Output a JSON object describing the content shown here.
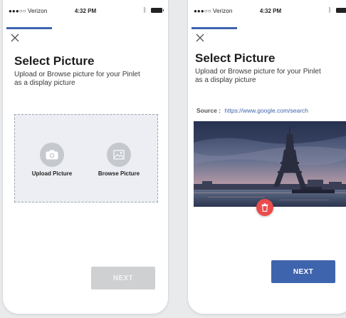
{
  "status_bar": {
    "carrier": "●●●○○ Verizon",
    "time": "4:32 PM",
    "bluetooth_icon": "bluetooth-icon",
    "battery_icon": "battery-icon"
  },
  "colors": {
    "accent": "#3f64ae",
    "delete": "#eb4b4b",
    "disabled_button": "#cfd0d2"
  },
  "screen_left": {
    "title": "Select Picture",
    "subtitle": "Upload or Browse picture for your Pinlet as a display picture",
    "upload_label": "Upload Picture",
    "browse_label": "Browse Picture",
    "next_label": "NEXT",
    "next_enabled": false
  },
  "screen_right": {
    "title": "Select Picture",
    "subtitle": "Upload or Browse picture for your Pinlet as a display picture",
    "source_label": "Source :",
    "source_url": "https://www.google.com/search",
    "next_label": "NEXT",
    "next_enabled": true
  }
}
